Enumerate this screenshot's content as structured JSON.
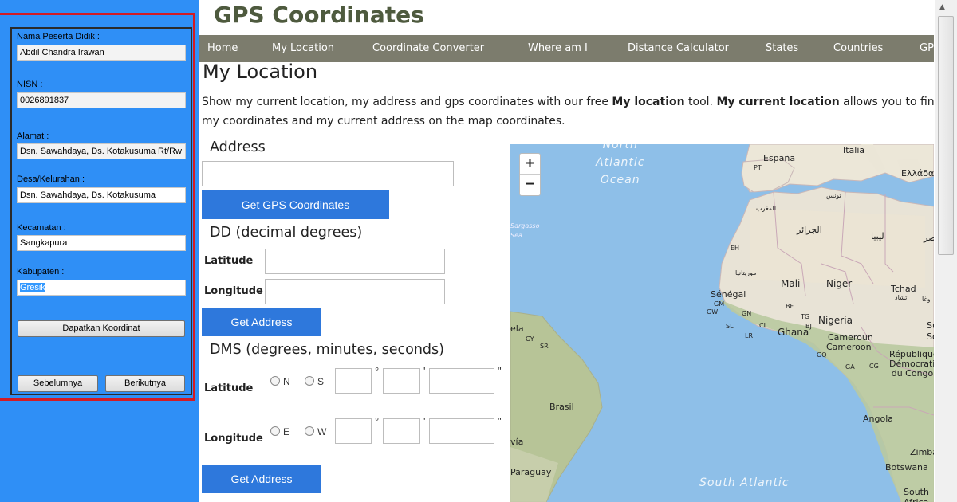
{
  "form": {
    "fields": [
      {
        "label": "Nama Peserta Didik :",
        "value": "Abdil Chandra Irawan"
      },
      {
        "label": "NISN :",
        "value": "0026891837"
      },
      {
        "label": "Alamat :",
        "value": "Dsn. Sawahdaya, Ds. Kotakusuma Rt/Rw :"
      },
      {
        "label": "Desa/Kelurahan :",
        "value": "Dsn. Sawahdaya, Ds. Kotakusuma"
      },
      {
        "label": "Kecamatan :",
        "value": "Sangkapura"
      },
      {
        "label": "Kabupaten :",
        "value": "Gresik"
      }
    ],
    "get_coords_button": "Dapatkan Koordinat",
    "prev_button": "Sebelumnya",
    "next_button": "Berikutnya"
  },
  "site": {
    "title": "GPS Coordinates",
    "nav": [
      "Home",
      "My Location",
      "Coordinate Converter",
      "Where am I",
      "Distance Calculator",
      "States",
      "Countries",
      "GPS"
    ]
  },
  "page": {
    "heading": "My Location",
    "intro_1": "Show my current location, my address and gps coordinates with our free ",
    "intro_bold_1": "My location",
    "intro_2": " tool. ",
    "intro_bold_2": "My current location",
    "intro_3": " allows you to find my coordinates and my current address on the map coordinates."
  },
  "address_section": {
    "heading": "Address",
    "button": "Get GPS Coordinates"
  },
  "dd_section": {
    "heading": "DD (decimal degrees)",
    "latitude_label": "Latitude",
    "longitude_label": "Longitude",
    "button": "Get Address"
  },
  "dms_section": {
    "heading": "DMS (degrees, minutes, seconds)",
    "latitude_label": "Latitude",
    "longitude_label": "Longitude",
    "north": "N",
    "south": "S",
    "east": "E",
    "west": "W",
    "deg": "°",
    "min": "'",
    "sec": "\"",
    "button": "Get Address"
  },
  "map": {
    "zoom_in": "+",
    "zoom_out": "−",
    "labels": [
      "North Atlantic Ocean",
      "Italia",
      "España",
      "PT",
      "Ελλάδα",
      "تونس",
      "المغرب",
      "الجزائر",
      "ليبيا",
      "مصر",
      "EH",
      "موريتانيا",
      "Mali",
      "Niger",
      "Tchad",
      "تشاد",
      "Sénégal",
      "GM",
      "BF",
      "GN",
      "Ghana",
      "Nigeria",
      "TG",
      "BJ",
      "CI",
      "LR",
      "SL",
      "GW",
      "SR",
      "GY",
      "Cameroun",
      "Cameroon",
      "République Démocratique du Congo",
      "GQ",
      "GA",
      "CG",
      "Sargasso Sea",
      "Brasil",
      "Angola",
      "Zimba",
      "Botswana",
      "Paraguay",
      "South Africa",
      "South Atlantic",
      "vía",
      "ela",
      "Sud",
      "Sou",
      "وغا"
    ]
  },
  "colors": {
    "left_panel": "#2f8ff6",
    "red_highlight": "#d21b24",
    "nav_bg": "#7c7c6d",
    "title": "#4e5a3e",
    "button_blue": "#2e78dc",
    "ocean": "#8ebfe8",
    "land": "#e8e3d6"
  }
}
